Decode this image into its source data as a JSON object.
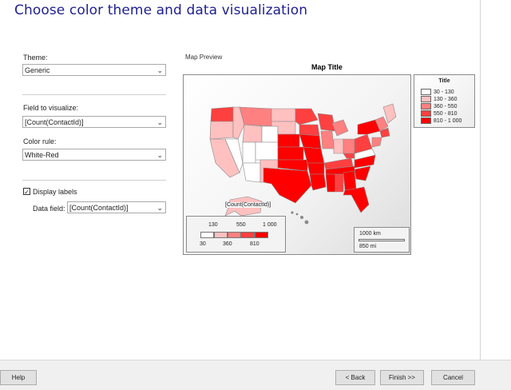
{
  "header": {
    "title": "Choose color theme and data visualization"
  },
  "left": {
    "theme_label": "Theme:",
    "theme_value": "Generic",
    "field_label": "Field to visualize:",
    "field_value": "[Count(ContactId)]",
    "color_rule_label": "Color rule:",
    "color_rule_value": "White-Red",
    "display_labels_checked": true,
    "display_labels_text": "Display labels",
    "data_field_label": "Data field:",
    "data_field_value": "[Count(ContactId)]"
  },
  "preview": {
    "label": "Map Preview",
    "map_title": "Map Title",
    "map_label": "[Count(ContactId)]",
    "legend": {
      "title": "Title",
      "items": [
        {
          "range": "30 - 130",
          "color": "#ffffff"
        },
        {
          "range": "130 - 360",
          "color": "#ffc0c0"
        },
        {
          "range": "360 - 550",
          "color": "#ff8080"
        },
        {
          "range": "550 - 810",
          "color": "#ff4040"
        },
        {
          "range": "810 - 1 000",
          "color": "#ff0000"
        }
      ]
    },
    "color_scale": {
      "top_labels": [
        "130",
        "550",
        "1 000"
      ],
      "bottom_labels": [
        "30",
        "360",
        "810"
      ],
      "colors": [
        "#ffffff",
        "#ffc0c0",
        "#ff8080",
        "#ff4040",
        "#ff0000"
      ]
    },
    "distance_scale": {
      "km": "1000 km",
      "mi": "850 mi"
    }
  },
  "footer": {
    "help": "Help",
    "back": "< Back",
    "finish": "Finish >>",
    "cancel": "Cancel"
  }
}
